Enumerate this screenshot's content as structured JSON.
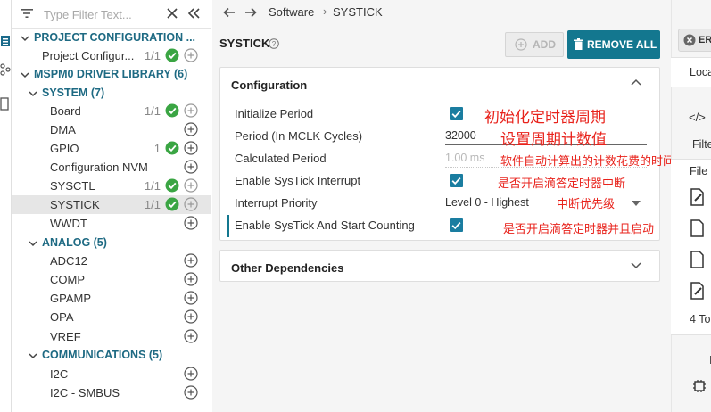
{
  "sidebar": {
    "filter_placeholder": "Type Filter Text...",
    "groups": {
      "project_configuration": {
        "label": "PROJECT CONFIGURATION ...",
        "items": [
          {
            "label": "Project Configur...",
            "count": "1/1",
            "status": "ok"
          }
        ]
      },
      "driver_library": {
        "label": "MSPM0 DRIVER LIBRARY (6)"
      },
      "system": {
        "label": "SYSTEM (7)",
        "items": [
          {
            "label": "Board",
            "count": "1/1",
            "status": "ok"
          },
          {
            "label": "DMA",
            "count": "",
            "status": ""
          },
          {
            "label": "GPIO",
            "count": "1",
            "status": "ok"
          },
          {
            "label": "Configuration NVM",
            "count": "",
            "status": ""
          },
          {
            "label": "SYSCTL",
            "count": "1/1",
            "status": "ok"
          },
          {
            "label": "SYSTICK",
            "count": "1/1",
            "status": "ok",
            "selected": true
          },
          {
            "label": "WWDT",
            "count": "",
            "status": ""
          }
        ]
      },
      "analog": {
        "label": "ANALOG (5)",
        "items": [
          {
            "label": "ADC12"
          },
          {
            "label": "COMP"
          },
          {
            "label": "GPAMP"
          },
          {
            "label": "OPA"
          },
          {
            "label": "VREF"
          }
        ]
      },
      "communications": {
        "label": "COMMUNICATIONS (5)",
        "items": [
          {
            "label": "I2C"
          },
          {
            "label": "I2C - SMBUS"
          }
        ]
      }
    }
  },
  "breadcrumb": {
    "items": [
      "Software",
      "SYSTICK"
    ]
  },
  "page": {
    "title": "SYSTICK",
    "add_label": "ADD",
    "remove_all_label": "REMOVE ALL"
  },
  "configuration": {
    "title": "Configuration",
    "rows": [
      {
        "label": "Initialize Period",
        "type": "checkbox",
        "checked": true
      },
      {
        "label": "Period (In MCLK Cycles)",
        "type": "text",
        "value": "32000"
      },
      {
        "label": "Calculated Period",
        "type": "text",
        "value": "1.00 ms",
        "disabled": true
      },
      {
        "label": "Enable SysTick Interrupt",
        "type": "checkbox",
        "checked": true
      },
      {
        "label": "Interrupt Priority",
        "type": "select",
        "value": "Level 0 - Highest"
      },
      {
        "label": "Enable SysTick And Start Counting",
        "type": "checkbox",
        "checked": true,
        "active": true
      }
    ]
  },
  "other_dependencies": {
    "title": "Other Dependencies"
  },
  "annotations": [
    "初始化定时器周期",
    "设置周期计数值",
    "软件自动计算出的计数花费的时间",
    "是否开启滴答定时器中断",
    "中断优先级",
    "是否开启滴答定时器并且启动"
  ],
  "right_panel": {
    "error_badge": "ER",
    "loc_label": "Loca",
    "code_icon": "</>",
    "filter_label": "Filte",
    "file_label": "File",
    "footer_text": "4 To",
    "bottom_letter": "I"
  },
  "colors": {
    "accent": "#13778f",
    "ok": "#3aa543",
    "group_text": "#1e6a83",
    "annotation": "#e8221b"
  }
}
